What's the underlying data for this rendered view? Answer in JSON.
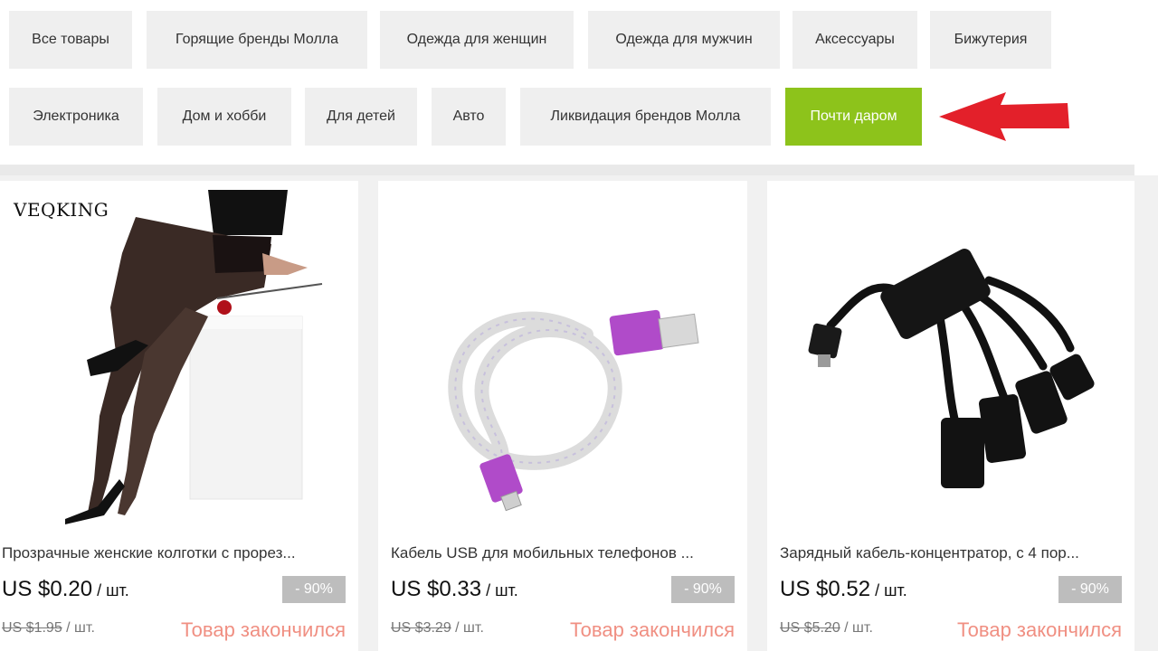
{
  "categories_row1": [
    {
      "label": "Все товары"
    },
    {
      "label": "Горящие бренды Молла"
    },
    {
      "label": "Одежда для женщин"
    },
    {
      "label": "Одежда для мужчин"
    },
    {
      "label": "Аксессуары"
    },
    {
      "label": "Бижутерия"
    }
  ],
  "categories_row2": [
    {
      "label": "Электроника"
    },
    {
      "label": "Дом и хобби"
    },
    {
      "label": "Для детей"
    },
    {
      "label": "Авто"
    },
    {
      "label": "Ликвидация брендов Молла"
    },
    {
      "label": "Почти даром",
      "active": true
    }
  ],
  "colors": {
    "active_category": "#8dc31b",
    "arrow": "#e3202a",
    "sold_out": "#f08f82",
    "discount_badge": "#bdbdbd"
  },
  "products": [
    {
      "brand": "VEQKING",
      "title": "Прозрачные женские колготки с прорез...",
      "price": "US $0.20",
      "unit": " / шт.",
      "discount": "- 90%",
      "old_price": "US $1.95",
      "old_unit": " / шт.",
      "status": "Товар закончился"
    },
    {
      "title": "Кабель USB для мобильных телефонов ...",
      "price": "US $0.33",
      "unit": " / шт.",
      "discount": "- 90%",
      "old_price": "US $3.29",
      "old_unit": " / шт.",
      "status": "Товар закончился"
    },
    {
      "title": "Зарядный кабель-концентратор, с 4 пор...",
      "price": "US $0.52",
      "unit": " / шт.",
      "discount": "- 90%",
      "old_price": "US $5.20",
      "old_unit": " / шт.",
      "status": "Товар закончился"
    }
  ]
}
